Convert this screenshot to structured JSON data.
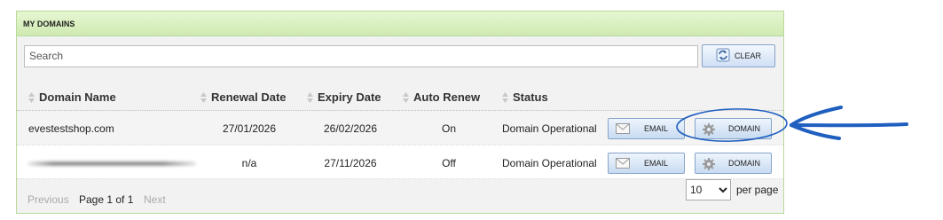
{
  "panel": {
    "title": "MY DOMAINS"
  },
  "search": {
    "placeholder": "Search",
    "value": "",
    "clear_label": "CLEAR"
  },
  "columns": [
    "Domain Name",
    "Renewal Date",
    "Expiry Date",
    "Auto Renew",
    "Status"
  ],
  "rows": [
    {
      "domain": "evestestshop.com",
      "renewal_date": "27/01/2026",
      "expiry_date": "26/02/2026",
      "auto_renew": "On",
      "status": "Domain Operational",
      "email_label": "EMAIL",
      "domain_label": "DOMAIN"
    },
    {
      "domain": "",
      "renewal_date": "n/a",
      "expiry_date": "27/11/2026",
      "auto_renew": "Off",
      "status": "Domain Operational",
      "email_label": "EMAIL",
      "domain_label": "DOMAIN"
    }
  ],
  "pagination": {
    "previous": "Previous",
    "info": "Page 1 of 1",
    "next": "Next",
    "per_page_value": "10",
    "per_page_label": "per page"
  },
  "colors": {
    "panel_border": "#b9d99a",
    "header_bg": "#d8efbf",
    "button_border": "#86a3c9",
    "annotation": "#1f5fbf"
  }
}
